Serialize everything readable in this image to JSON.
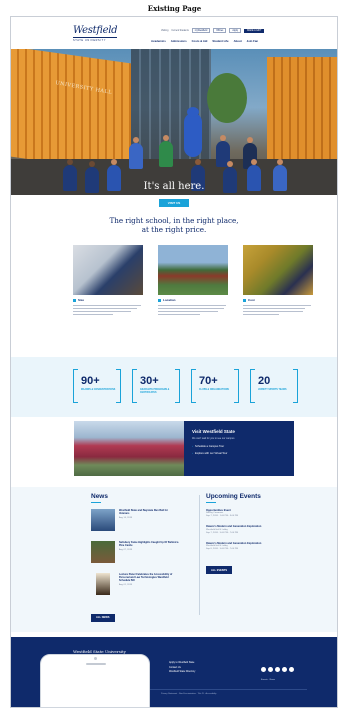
{
  "caption": "Existing Page",
  "header": {
    "logo": "Westfield",
    "logo_sub": "STATE UNIVERSITY",
    "utility": [
      "Visiting",
      "Current Students",
      "myWestfield",
      "Offices",
      "Apply",
      "MAKE A GIFT"
    ],
    "nav": [
      "Academics",
      "Admissions",
      "Costs & Aid",
      "Student Life",
      "About",
      "Join Fan"
    ]
  },
  "hero": {
    "sign": "UNIVERSITY HALL",
    "title": "It's all here.",
    "button": "VISIT US"
  },
  "intro": {
    "title_line1": "The right school, in the right place,",
    "title_line2": "at the right price.",
    "features": [
      {
        "label": "Size"
      },
      {
        "label": "Location"
      },
      {
        "label": "Cost"
      }
    ]
  },
  "stats": [
    {
      "value": "90+",
      "label": "MAJORS & CONCENTRATIONS"
    },
    {
      "value": "30+",
      "label": "GRADUATE PROGRAMS & CERTIFICATES"
    },
    {
      "value": "70+",
      "label": "CLUBS & ORGANIZATIONS"
    },
    {
      "value": "20",
      "label": "VARSITY SPORTS TEAMS"
    }
  ],
  "visit": {
    "title": "Visit Westfield State",
    "subtitle": "We can't wait for you to see our campus",
    "options": [
      "Schedule a Campus Tour",
      "Explore with our Virtual Tour"
    ]
  },
  "news": {
    "title": "News",
    "items": [
      {
        "headline": "Westfield State and Baystate Run Ball for Veterans",
        "date": "Aug 14, 2018"
      },
      {
        "headline": "Salisbury Fame Highlights Caught Up Of Behind a Pine Castle",
        "date": "Aug 07, 2018"
      },
      {
        "headline": "Lecture Panel Celebrates the Accessibility of Personal and Law Technologies Westfield Schedule Bill",
        "date": "Aug 01, 2018"
      }
    ],
    "button": "ALL NEWS"
  },
  "events": {
    "title": "Upcoming Events",
    "items": [
      {
        "title": "Opportunities Event",
        "location": "Stirling Commons",
        "time": "Sep 7, 2018 · 1:00 PM - 3:00 PM"
      },
      {
        "title": "Owens's Modern and Generation Exploration",
        "location": "Westfield Hall 4 Lobby",
        "time": "Sep 7, 2018 · 5:00 PM - 7:00 PM"
      },
      {
        "title": "Owens's Modern and Generation Exploration",
        "location": "Westfield Hall 4 Lobby",
        "time": "Sep 8, 2018 · 5:00 PM - 7:00 PM"
      }
    ],
    "button": "ALL EVENTS"
  },
  "footer": {
    "name": "Westfield State University",
    "address1": "577 Western Avenue",
    "address2": "Westfield, MA 01086",
    "directions": "Maps & Directions",
    "links": [
      "Apply to Westfield State",
      "Contact Us",
      "Westfield State Directory"
    ],
    "small_links": "Events  ·  News",
    "legal": "Privacy Statement  ·  Non-Discrimination  ·  Title IX  ·  Accessibility"
  },
  "colors": {
    "navy": "#0f2a6b",
    "accent": "#1aa3d9"
  }
}
